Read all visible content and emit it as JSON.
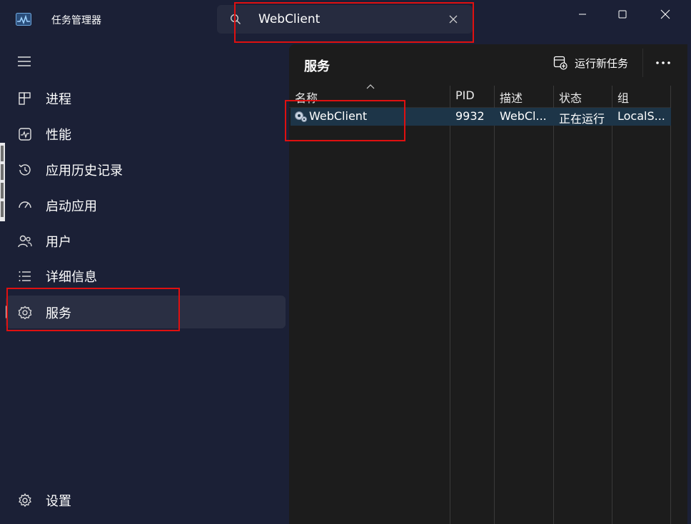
{
  "window": {
    "title": "任务管理器"
  },
  "search": {
    "value": "WebClient",
    "placeholder": ""
  },
  "sidebar": {
    "items": [
      {
        "label": "进程",
        "icon": "processes-icon"
      },
      {
        "label": "性能",
        "icon": "performance-icon"
      },
      {
        "label": "应用历史记录",
        "icon": "app-history-icon"
      },
      {
        "label": "启动应用",
        "icon": "startup-apps-icon"
      },
      {
        "label": "用户",
        "icon": "users-icon"
      },
      {
        "label": "详细信息",
        "icon": "details-icon"
      },
      {
        "label": "服务",
        "icon": "services-icon",
        "active": true
      }
    ],
    "settings_label": "设置"
  },
  "content": {
    "title": "服务",
    "run_new_task_label": "运行新任务"
  },
  "table": {
    "columns": [
      "名称",
      "PID",
      "描述",
      "状态",
      "组"
    ],
    "rows": [
      {
        "name": "WebClient",
        "pid": "9932",
        "description": "WebCl...",
        "status": "正在运行",
        "group": "LocalS..."
      }
    ]
  },
  "colors": {
    "sidebar_bg": "#1b2036",
    "content_bg": "#1c1c1c",
    "selected_row": "#1d3548",
    "annotation": "#e01010"
  }
}
